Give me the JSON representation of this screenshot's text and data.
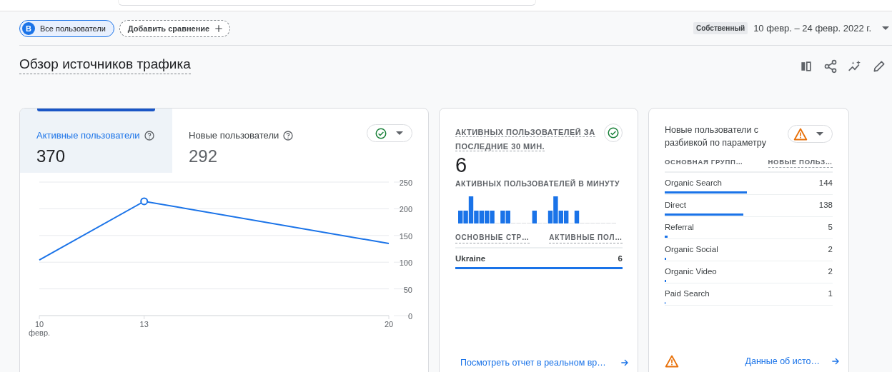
{
  "top_bar": {
    "search": {
      "kind": "search"
    },
    "segments": [
      {
        "avatar": "В",
        "label": "Все пользователи",
        "selected": true
      }
    ],
    "add_comparison": "Добавить сравнение",
    "date_range_type": "Собственный",
    "date_range": "10 февр. – 24 февр. 2022 г."
  },
  "title": "Обзор источников трафика",
  "users_card": {
    "metrics": [
      {
        "label": "Активные пользователи",
        "value": "370",
        "selected": true
      },
      {
        "label": "Новые пользователи",
        "value": "292",
        "selected": false
      }
    ],
    "status": {
      "kind": "ok"
    },
    "chart_data": {
      "type": "line",
      "x": [
        10,
        13,
        20
      ],
      "series": [
        {
          "color": "#1a73e8",
          "values": [
            104,
            214,
            135
          ]
        }
      ],
      "grid": true,
      "xlim": [
        10,
        20
      ],
      "ylim": [
        0,
        250
      ],
      "xticks": [
        {
          "value": 10,
          "label": "10 февр."
        },
        13,
        20
      ],
      "yticks": [
        0,
        50,
        100,
        150,
        200,
        250
      ]
    }
  },
  "realtime_card": {
    "title": "АКТИВНЫХ ПОЛЬЗОВАТЕЛЕЙ ЗА ПОСЛЕДНИЕ 30 МИН.",
    "status": {
      "kind": "ok"
    },
    "value": "6",
    "subtitle": "АКТИВНЫХ ПОЛЬЗОВАТЕЛЕЙ В МИНУТУ",
    "columns": [
      "ОСНОВНЫЕ СТР…",
      "АКТИВНЫЕ ПОЛ…"
    ],
    "rows": [
      {
        "name": "Ukraine",
        "value": "6"
      }
    ],
    "link": "Посмотреть отчет в реальном вр…"
  },
  "dimension_card": {
    "title": "Новые пользователи с разбивкой по параметру",
    "status": {
      "kind": "warning"
    },
    "columns": [
      "ОСНОВНАЯ ГРУПП…",
      "НОВЫЕ ПОЛЬЗ…"
    ],
    "rows": [
      {
        "name": "Organic Search",
        "value": "144",
        "level": 0.49
      },
      {
        "name": "Direct",
        "value": "138",
        "level": 0.47
      },
      {
        "name": "Referral",
        "value": "5",
        "level": 0.017
      },
      {
        "name": "Organic Social",
        "value": "2",
        "level": 0.007
      },
      {
        "name": "Organic Video",
        "value": "2",
        "level": 0.007
      },
      {
        "name": "Paid Search",
        "value": "1",
        "level": 0.003
      }
    ],
    "footer_status": {
      "kind": "warning"
    },
    "link": "Данные об исто…"
  }
}
